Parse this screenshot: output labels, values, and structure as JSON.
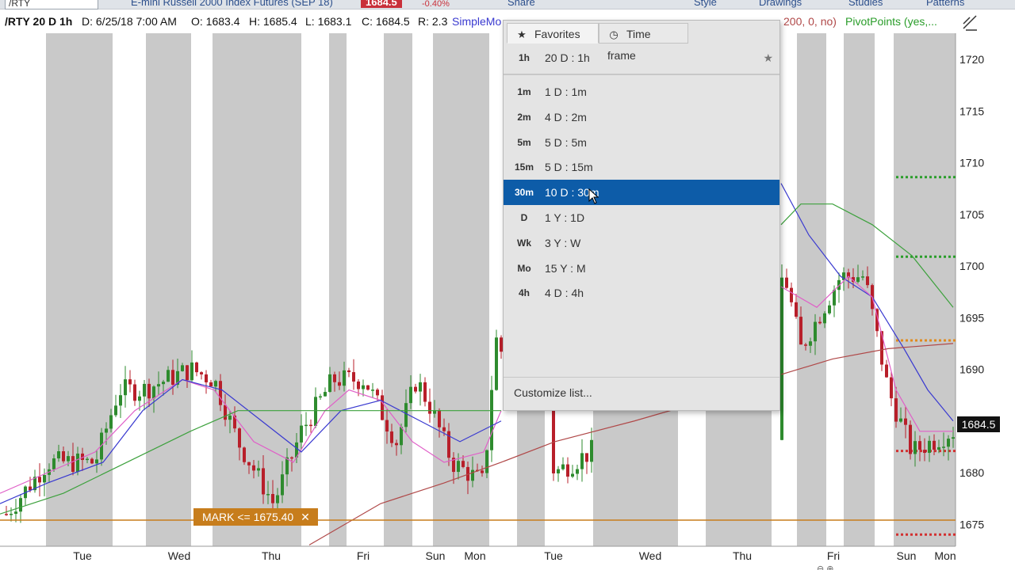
{
  "toolbar": {
    "symbol": "/RTY",
    "description": "E-mini Russell 2000 Index Futures (SEP 18)",
    "last_price": "1684.5",
    "change_pct": "-0.40%",
    "share_label": "Share",
    "style_label": "Style",
    "drawings_label": "Drawings",
    "studies_label": "Studies",
    "patterns_label": "Patterns"
  },
  "infobar": {
    "symbol_tf": "/RTY 20 D 1h",
    "date": "D: 6/25/18 7:00 AM",
    "open": "O: 1683.4",
    "high": "H: 1685.4",
    "low": "L: 1683.1",
    "close": "C: 1684.5",
    "range": "R: 2.3",
    "study1": "SimpleMo",
    "study2": "200, 0, no)",
    "study3": "PivotPoints (yes,..."
  },
  "dropdown": {
    "tabs": [
      {
        "label": "Favorites",
        "icon": "star-icon"
      },
      {
        "label": "Time frame",
        "icon": "clock-icon"
      }
    ],
    "favorite": {
      "code": "1h",
      "label": "20 D : 1h"
    },
    "items": [
      {
        "code": "1m",
        "label": "1 D : 1m"
      },
      {
        "code": "2m",
        "label": "4 D : 2m"
      },
      {
        "code": "5m",
        "label": "5 D : 5m"
      },
      {
        "code": "15m",
        "label": "5 D : 15m"
      },
      {
        "code": "30m",
        "label": "10 D : 30m",
        "selected": true
      },
      {
        "code": "D",
        "label": "1 Y : 1D"
      },
      {
        "code": "Wk",
        "label": "3 Y : W"
      },
      {
        "code": "Mo",
        "label": "15 Y : M"
      },
      {
        "code": "4h",
        "label": "4 D : 4h"
      }
    ],
    "customize_label": "Customize list..."
  },
  "mark_label": "MARK <= 1675.40",
  "current_price_tag": "1684.5",
  "chart_data": {
    "type": "candlestick",
    "x_labels": [
      "Tue",
      "Wed",
      "Thu",
      "Fri",
      "Sun",
      "Mon",
      "Tue",
      "Wed",
      "Thu",
      "Fri",
      "Sun",
      "Mon"
    ],
    "y_ticks": [
      1720,
      1715,
      1710,
      1705,
      1700,
      1695,
      1690,
      1685,
      1680,
      1675
    ],
    "ylim": [
      1673,
      1723
    ],
    "mark_level": 1675.4,
    "last_price": 1684.5,
    "pivot_levels": [
      {
        "value": 1708.6,
        "color": "#2a9d2a"
      },
      {
        "value": 1700.9,
        "color": "#2a9d2a"
      },
      {
        "value": 1692.8,
        "color": "#e08a1e"
      },
      {
        "value": 1682.1,
        "color": "#d23030"
      },
      {
        "value": 1674.0,
        "color": "#d23030"
      }
    ],
    "colors": {
      "up": "#2e8b2e",
      "down": "#b81f2a",
      "ma_blue": "#3a3ad0",
      "ma_pink": "#e05fc8",
      "ma_green": "#3da13d",
      "ma_red": "#b04848",
      "mark": "#c77d1c"
    }
  }
}
